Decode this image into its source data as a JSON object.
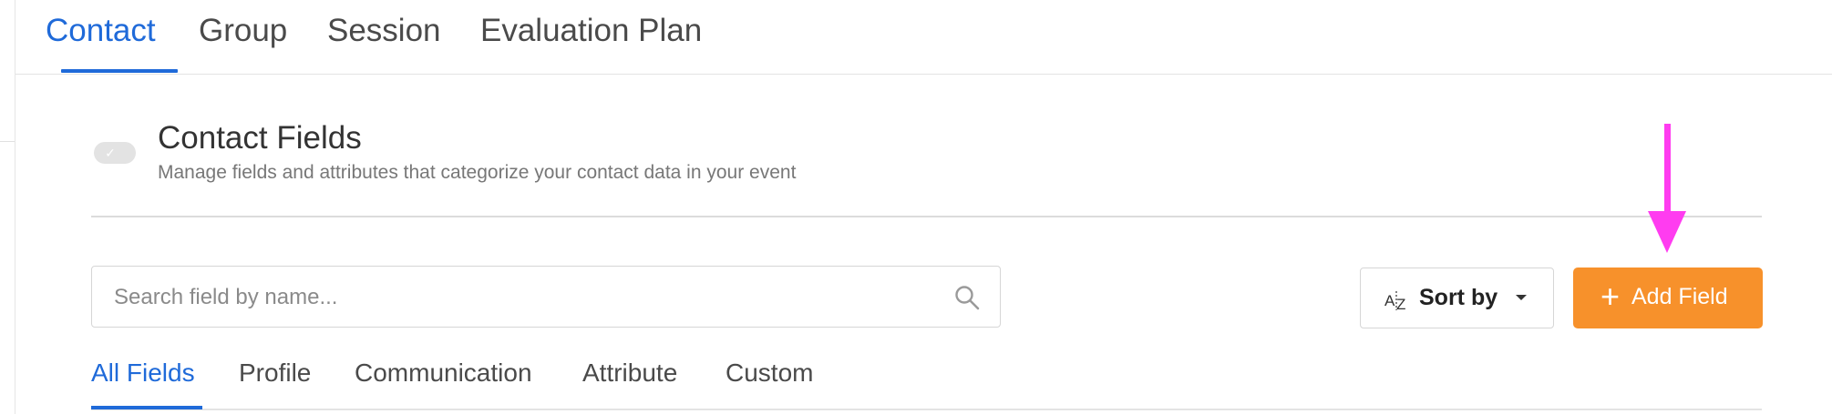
{
  "top_tabs": [
    {
      "label": "Contact",
      "active": true
    },
    {
      "label": "Group",
      "active": false
    },
    {
      "label": "Session",
      "active": false
    },
    {
      "label": "Evaluation Plan",
      "active": false
    }
  ],
  "section": {
    "title": "Contact Fields",
    "subtitle": "Manage fields and attributes that categorize your contact data in your event",
    "toggle_icon": "check-icon",
    "toggle_enabled": false
  },
  "search": {
    "value": "",
    "placeholder": "Search field by name...",
    "icon": "search-icon"
  },
  "sort": {
    "label": "Sort by",
    "icon": "sort-az-icon"
  },
  "add_field": {
    "label": "Add Field",
    "icon": "plus-icon",
    "color": "#f7912b"
  },
  "annotation": {
    "type": "arrow-down",
    "color": "#ff3cf0"
  },
  "field_tabs": [
    {
      "label": "All Fields",
      "active": true
    },
    {
      "label": "Profile",
      "active": false
    },
    {
      "label": "Communication",
      "active": false
    },
    {
      "label": "Attribute",
      "active": false
    },
    {
      "label": "Custom",
      "active": false
    }
  ],
  "colors": {
    "accent": "#1f6ad9",
    "text": "#4a4a4a",
    "muted": "#777777"
  }
}
